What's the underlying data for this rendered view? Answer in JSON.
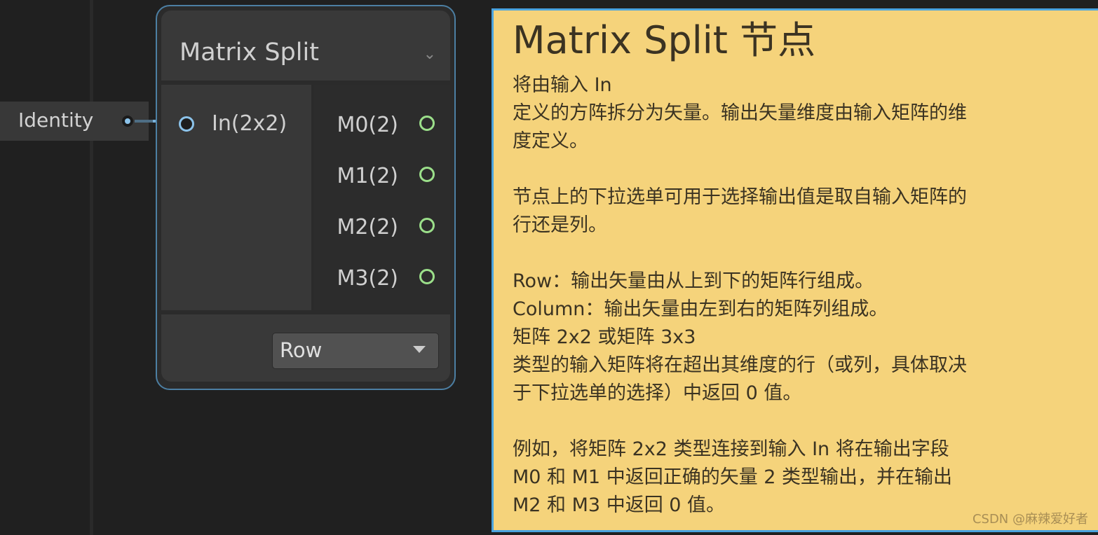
{
  "graph": {
    "input_node": {
      "label": "Identity"
    },
    "node": {
      "title": "Matrix Split",
      "inputs": [
        {
          "label": "In(2x2)"
        }
      ],
      "outputs": [
        {
          "label": "M0(2)"
        },
        {
          "label": "M1(2)"
        },
        {
          "label": "M2(2)"
        },
        {
          "label": "M3(2)"
        }
      ],
      "dropdown": {
        "value": "Row"
      }
    }
  },
  "tooltip": {
    "title": "Matrix Split 节点",
    "lines": [
      "将由输入 In",
      "定义的方阵拆分为矢量。输出矢量维度由输入矩阵的维",
      "度定义。",
      "",
      "节点上的下拉选单可用于选择输出值是取自输入矩阵的",
      "行还是列。",
      "",
      "Row：输出矢量由从上到下的矩阵行组成。",
      "Column：输出矢量由左到右的矩阵列组成。",
      "矩阵 2x2 或矩阵 3x3",
      "类型的输入矩阵将在超出其维度的行（或列，具体取决",
      "于下拉选单的选择）中返回 0 值。",
      "",
      "例如，将矩阵 2x2 类型连接到输入 In 将在输出字段",
      "M0 和 M1 中返回正确的矢量 2 类型输出，并在输出",
      "M2 和 M3 中返回 0 值。"
    ]
  },
  "watermark": "CSDN @麻辣爱好者",
  "colors": {
    "background": "#202020",
    "node_border": "#4c7fa3",
    "output_port": "#9bdf8a",
    "input_port": "#8cc3ea",
    "tooltip_bg": "#f5d37b",
    "tooltip_border": "#4aa3df"
  }
}
